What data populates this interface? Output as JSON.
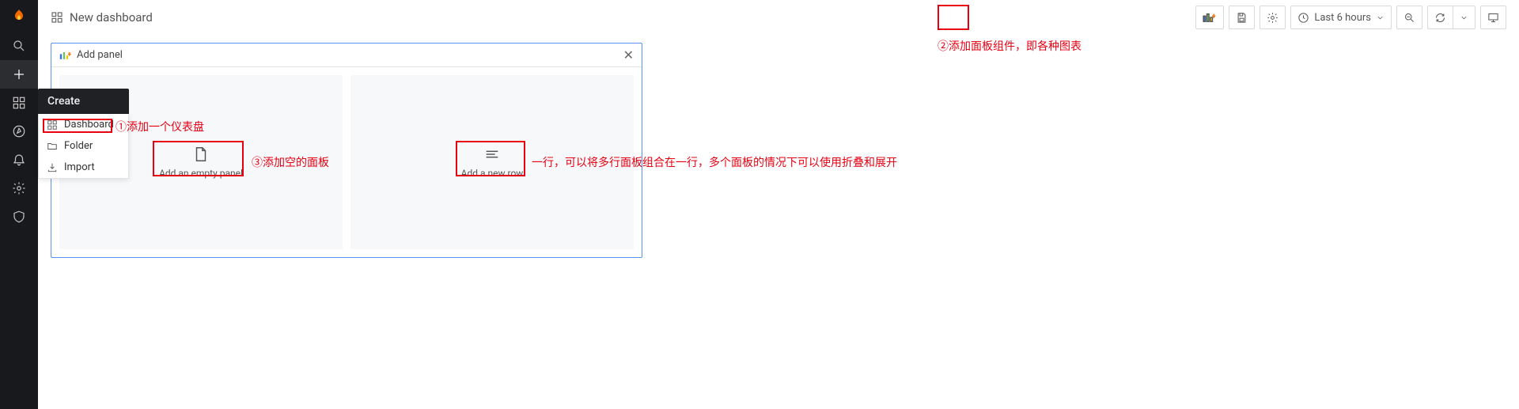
{
  "nav": {
    "create_label": "Create",
    "create_items": [
      {
        "label": "Dashboard"
      },
      {
        "label": "Folder"
      },
      {
        "label": "Import"
      }
    ]
  },
  "header": {
    "title": "New dashboard",
    "time_label": "Last 6 hours"
  },
  "add_panel": {
    "title": "Add panel",
    "empty_panel": "Add an empty panel",
    "new_row": "Add a new row"
  },
  "annotations": {
    "a1": "①添加一个仪表盘",
    "a2": "②添加面板组件，即各种图表",
    "a3": "③添加空的面板",
    "a4": "一行，可以将多行面板组合在一行，多个面板的情况下可以使用折叠和展开"
  }
}
